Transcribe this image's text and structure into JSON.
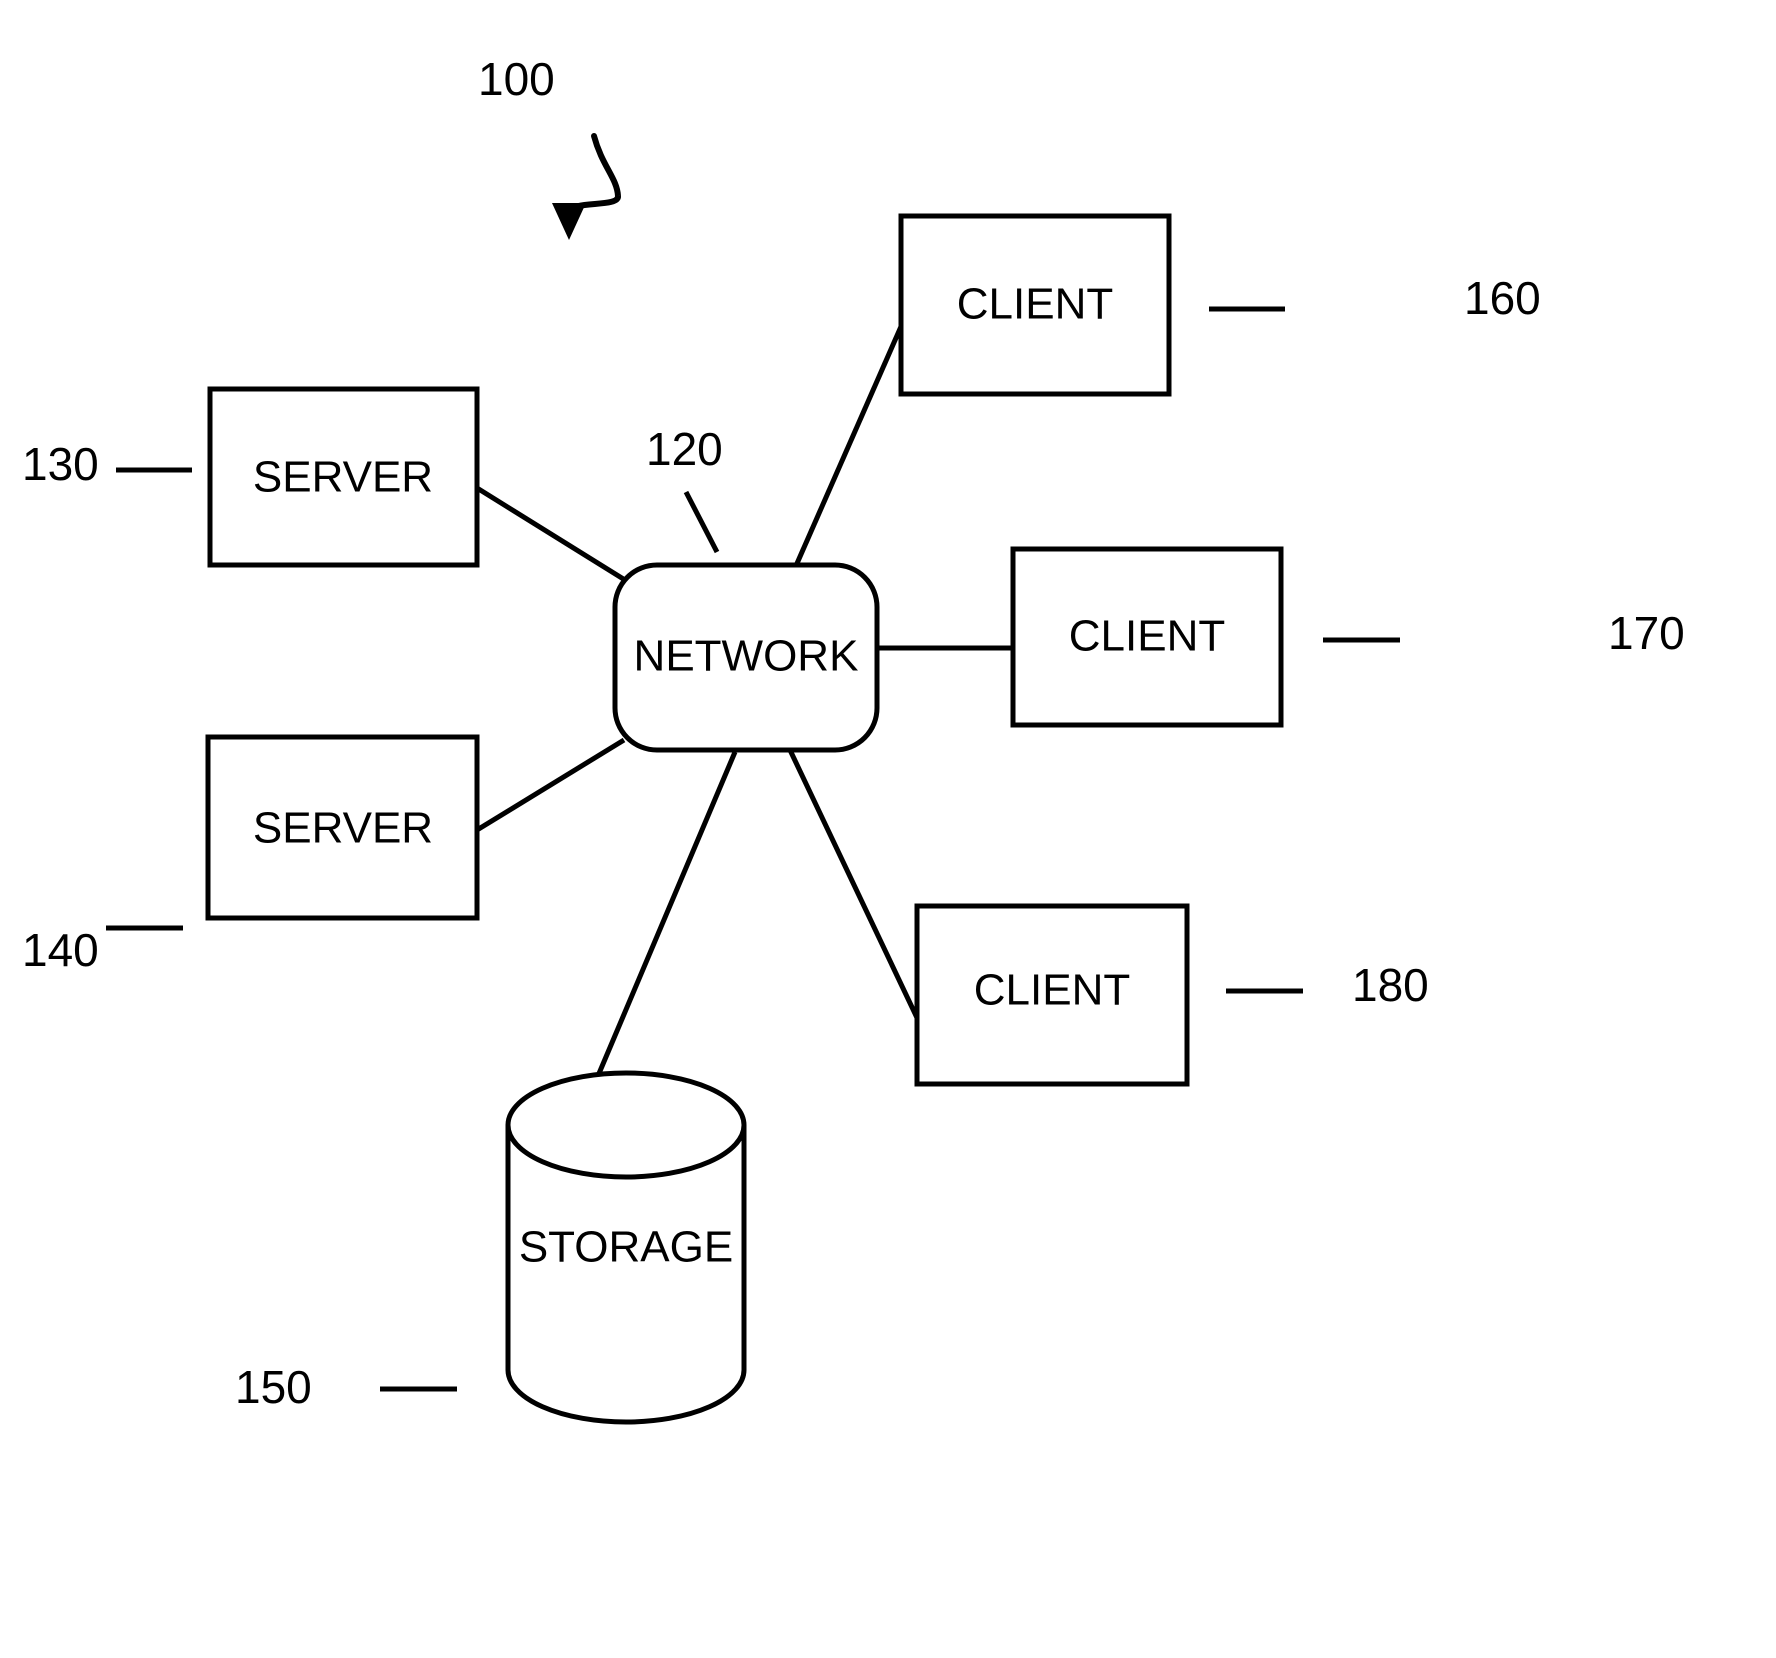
{
  "figure": {
    "reference_numeral": "100",
    "type": "patent-network-diagram",
    "background_color": "#ffffff",
    "line_color": "#000000"
  },
  "nodes": {
    "network": {
      "label": "NETWORK",
      "ref": "120",
      "shape": "rounded-rectangle"
    },
    "server_top": {
      "label": "SERVER",
      "ref": "130",
      "shape": "rectangle"
    },
    "server_bottom": {
      "label": "SERVER",
      "ref": "140",
      "shape": "rectangle"
    },
    "storage": {
      "label": "STORAGE",
      "ref": "150",
      "shape": "cylinder"
    },
    "client_top": {
      "label": "CLIENT",
      "ref": "160",
      "shape": "rectangle"
    },
    "client_middle": {
      "label": "CLIENT",
      "ref": "170",
      "shape": "rectangle"
    },
    "client_bottom": {
      "label": "CLIENT",
      "ref": "180",
      "shape": "rectangle"
    }
  },
  "connections": [
    {
      "from": "server_top",
      "to": "network"
    },
    {
      "from": "server_bottom",
      "to": "network"
    },
    {
      "from": "storage",
      "to": "network"
    },
    {
      "from": "client_top",
      "to": "network"
    },
    {
      "from": "client_middle",
      "to": "network"
    },
    {
      "from": "client_bottom",
      "to": "network"
    }
  ]
}
